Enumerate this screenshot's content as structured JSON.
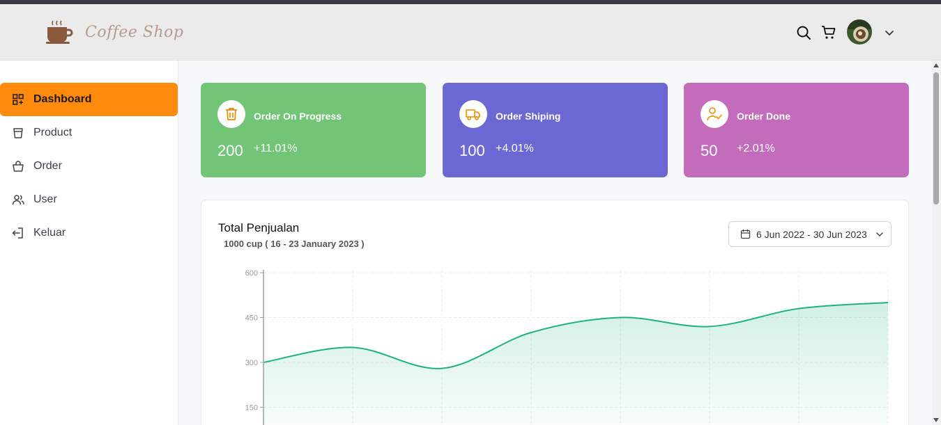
{
  "header": {
    "logo_text": "Coffee Shop",
    "icons": [
      "search-icon",
      "cart-icon",
      "chevron-down-icon"
    ]
  },
  "sidebar": {
    "items": [
      {
        "label": "Dashboard",
        "icon": "dashboard-icon",
        "active": true
      },
      {
        "label": "Product",
        "icon": "cup-icon",
        "active": false
      },
      {
        "label": "Order",
        "icon": "bag-icon",
        "active": false
      },
      {
        "label": "User",
        "icon": "users-icon",
        "active": false
      },
      {
        "label": "Keluar",
        "icon": "logout-icon",
        "active": false
      }
    ]
  },
  "cards": [
    {
      "title": "Order On Progress",
      "value": "200",
      "delta": "+11.01%",
      "color": "#72c477",
      "icon": "trash-icon"
    },
    {
      "title": "Order Shiping",
      "value": "100",
      "delta": "+4.01%",
      "color": "#6b68d4",
      "icon": "truck-icon"
    },
    {
      "title": "Order Done",
      "value": "50",
      "delta": "+2.01%",
      "color": "#c46cbc",
      "icon": "user-check-icon"
    }
  ],
  "sales": {
    "title": "Total Penjualan",
    "subtitle": "1000 cup ( 16 - 23 January 2023 )",
    "date_range": "6 Jun 2022 - 30 Jun 2023"
  },
  "chart_data": {
    "type": "area",
    "x": [
      0,
      1,
      2,
      3,
      4,
      5,
      6,
      7
    ],
    "values": [
      300,
      350,
      280,
      400,
      450,
      420,
      480,
      500
    ],
    "yticks": [
      "600",
      "450",
      "300",
      "150"
    ],
    "ylim": [
      0,
      600
    ],
    "color": "#1db37b",
    "grid": true
  }
}
